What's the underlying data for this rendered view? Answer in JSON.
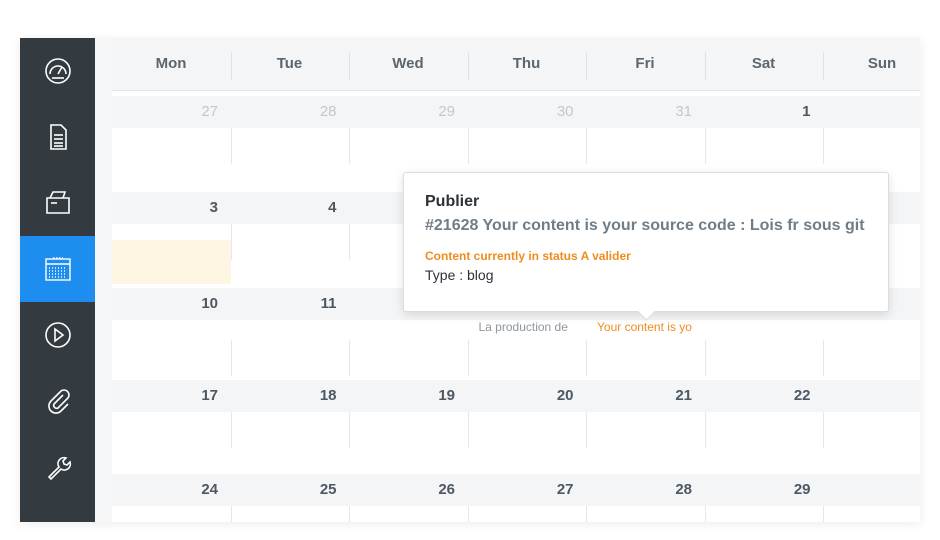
{
  "sidebar": {
    "items": [
      {
        "icon": "dashboard-icon"
      },
      {
        "icon": "document-icon"
      },
      {
        "icon": "folder-icon"
      },
      {
        "icon": "calendar-icon",
        "active": true
      },
      {
        "icon": "play-icon"
      },
      {
        "icon": "paperclip-icon"
      },
      {
        "icon": "wrench-icon"
      }
    ],
    "active_color": "#1d8df0",
    "background": "#333b41"
  },
  "calendar": {
    "weekdays": [
      "Mon",
      "Tue",
      "Wed",
      "Thu",
      "Fri",
      "Sat",
      "Sun"
    ],
    "weeks": [
      {
        "days": [
          "27",
          "28",
          "29",
          "30",
          "31",
          "1",
          ""
        ],
        "out": [
          true,
          true,
          true,
          true,
          true,
          false,
          false
        ]
      },
      {
        "days": [
          "3",
          "4",
          "",
          "",
          "",
          "",
          ""
        ],
        "out": [
          false,
          false,
          false,
          false,
          false,
          false,
          false
        ]
      },
      {
        "days": [
          "10",
          "11",
          "",
          "",
          "",
          "",
          ""
        ],
        "out": [
          false,
          false,
          false,
          false,
          false,
          false,
          false
        ]
      },
      {
        "days": [
          "17",
          "18",
          "19",
          "20",
          "21",
          "22",
          ""
        ],
        "out": [
          false,
          false,
          false,
          false,
          false,
          false,
          false
        ]
      },
      {
        "days": [
          "24",
          "25",
          "26",
          "27",
          "28",
          "29",
          ""
        ],
        "out": [
          false,
          false,
          false,
          false,
          false,
          false,
          false
        ]
      }
    ],
    "events": [
      {
        "label": "La production de",
        "color": "grey"
      },
      {
        "label": "Your content is yo",
        "color": "orange"
      }
    ]
  },
  "tooltip": {
    "title": "Publier",
    "subtitle": "#21628 Your content is your source code : Lois fr sous git",
    "status": "Content currently in status A valider",
    "type": "Type : blog"
  },
  "colors": {
    "accent": "#f08c1e",
    "today": "#fdf6e3"
  }
}
